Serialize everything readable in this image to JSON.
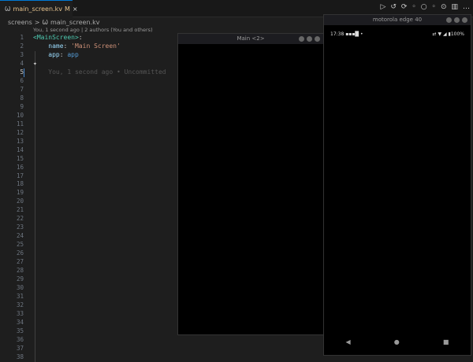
{
  "tab": {
    "filename": "main_screen.kv",
    "modified": "M",
    "close": "×"
  },
  "breadcrumb": {
    "folder": "screens",
    "sep": ">",
    "file": "main_screen.kv"
  },
  "codelens": "You, 1 second ago | 2 authors (You and others)",
  "code": {
    "l1_tag": "<MainScreen>",
    "l1_colon": ":",
    "l2_key": "name",
    "l2_val": "'Main Screen'",
    "l3_key": "app",
    "l3_val": "app",
    "l4_sparkle": "✦",
    "l5_blame": "You, 1 second ago • Uncommitted"
  },
  "line_numbers": [
    1,
    2,
    3,
    4,
    5,
    6,
    7,
    8,
    9,
    10,
    11,
    12,
    13,
    14,
    15,
    16,
    17,
    18,
    19,
    20,
    21,
    22,
    23,
    24,
    25,
    26,
    27,
    28,
    29,
    30,
    31,
    32,
    33,
    34,
    35,
    36,
    37,
    38
  ],
  "actions": [
    "▷",
    "↺",
    "⟳",
    "◦",
    "○",
    "◦",
    "⊙",
    "▥",
    "…"
  ],
  "window1": {
    "title": "Main <2>"
  },
  "window2": {
    "title": "motorola edge 40",
    "time": "17:38",
    "status_right": "▮100%",
    "nav": {
      "back": "◀",
      "home": "●",
      "recents": "■"
    }
  }
}
